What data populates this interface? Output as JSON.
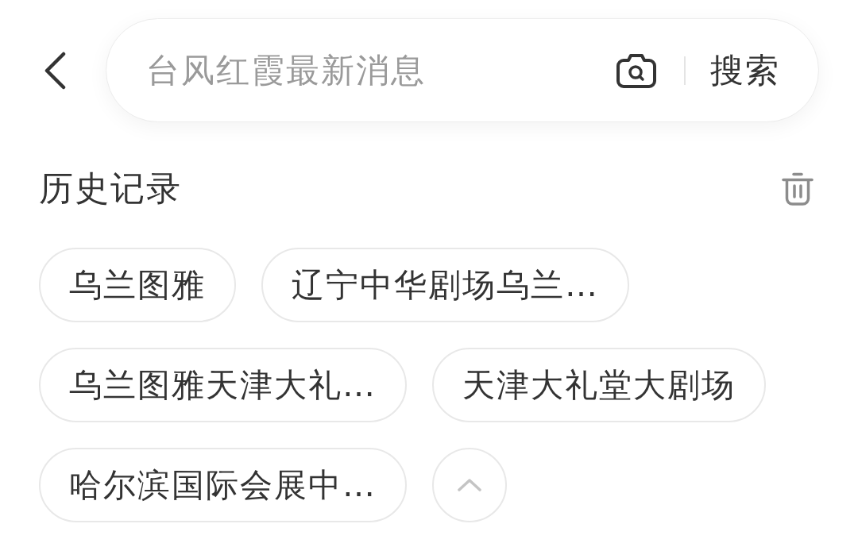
{
  "top_bar": {
    "search": {
      "placeholder": "台风红霞最新消息",
      "button": "搜索"
    }
  },
  "history": {
    "title": "历史记录",
    "items": [
      "乌兰图雅",
      "辽宁中华剧场乌兰…",
      "乌兰图雅天津大礼…",
      "天津大礼堂大剧场",
      "哈尔滨国际会展中…"
    ],
    "expanded": true
  }
}
